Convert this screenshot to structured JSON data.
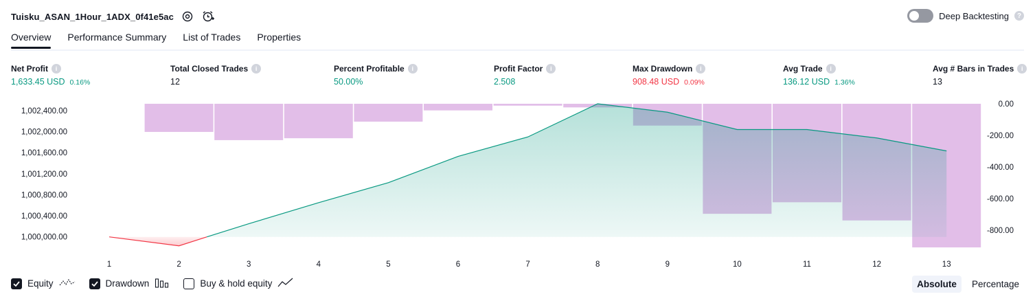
{
  "header": {
    "strategy_title": "Tuisku_ASAN_1Hour_1ADX_0f41e5ac",
    "deep_backtesting_label": "Deep Backtesting",
    "help_glyph": "?"
  },
  "tabs": [
    {
      "label": "Overview",
      "active": true
    },
    {
      "label": "Performance Summary",
      "active": false
    },
    {
      "label": "List of Trades",
      "active": false
    },
    {
      "label": "Properties",
      "active": false
    }
  ],
  "metrics": [
    {
      "label": "Net Profit",
      "value": "1,633.45 USD",
      "pct": "0.16%",
      "color": "#089981"
    },
    {
      "label": "Total Closed Trades",
      "value": "12",
      "pct": "",
      "color": "#131722"
    },
    {
      "label": "Percent Profitable",
      "value": "50.00%",
      "pct": "",
      "color": "#089981"
    },
    {
      "label": "Profit Factor",
      "value": "2.508",
      "pct": "",
      "color": "#089981"
    },
    {
      "label": "Max Drawdown",
      "value": "908.48 USD",
      "pct": "0.09%",
      "color": "#f23645"
    },
    {
      "label": "Avg Trade",
      "value": "136.12 USD",
      "pct": "1.36%",
      "color": "#089981"
    },
    {
      "label": "Avg # Bars in Trades",
      "value": "13",
      "pct": "",
      "color": "#131722"
    }
  ],
  "info_glyph": "i",
  "chart_data": {
    "type": "line",
    "x": [
      1,
      2,
      3,
      4,
      5,
      6,
      7,
      8,
      9,
      10,
      11,
      12,
      13
    ],
    "x_ticks": [
      "1",
      "2",
      "3",
      "4",
      "5",
      "6",
      "7",
      "8",
      "9",
      "10",
      "11",
      "12",
      "13"
    ],
    "left_axis": {
      "ticks": [
        "1,002,400.00",
        "1,002,000.00",
        "1,001,600.00",
        "1,001,200.00",
        "1,000,800.00",
        "1,000,400.00",
        "1,000,000.00"
      ],
      "tick_values": [
        1002400,
        1002000,
        1001600,
        1001200,
        1000800,
        1000400,
        1000000
      ],
      "ylim": [
        999800,
        1002530
      ]
    },
    "right_axis": {
      "ticks": [
        "0.00",
        "-200.00",
        "-400.00",
        "-600.00",
        "-800.00"
      ],
      "tick_values": [
        0,
        -200,
        -400,
        -600,
        -800
      ],
      "ylim": [
        -908.48,
        0
      ]
    },
    "series": [
      {
        "name": "Equity",
        "axis": "left",
        "x": [
          1,
          2,
          2.4,
          3,
          4,
          5,
          6,
          7,
          8,
          9,
          10,
          11,
          12,
          13
        ],
        "values": [
          1000000,
          999830,
          1000000,
          1000250,
          1000650,
          1001030,
          1001530,
          1001900,
          1002530,
          1002370,
          1002040,
          1002040,
          1001880,
          1001633.45
        ]
      },
      {
        "name": "Drawdown",
        "axis": "right",
        "bars": [
          {
            "x": 2,
            "value": -178
          },
          {
            "x": 3,
            "value": -230
          },
          {
            "x": 4,
            "value": -218
          },
          {
            "x": 5,
            "value": -113
          },
          {
            "x": 6,
            "value": -42
          },
          {
            "x": 7,
            "value": -12
          },
          {
            "x": 8,
            "value": -23
          },
          {
            "x": 9,
            "value": -138
          },
          {
            "x": 10,
            "value": -696
          },
          {
            "x": 11,
            "value": -623
          },
          {
            "x": 12,
            "value": -738
          },
          {
            "x": 13,
            "value": -908.48
          }
        ]
      }
    ],
    "colors": {
      "equity_positive": "#089981",
      "equity_negative": "#f23645",
      "drawdown": "#ce93d8"
    }
  },
  "legend": [
    {
      "label": "Equity",
      "checked": true,
      "icon": "equity-line-icon"
    },
    {
      "label": "Drawdown",
      "checked": true,
      "icon": "drawdown-bars-icon"
    },
    {
      "label": "Buy & hold equity",
      "checked": false,
      "icon": "buy-hold-line-icon"
    }
  ],
  "mode_buttons": [
    {
      "label": "Absolute",
      "active": true
    },
    {
      "label": "Percentage",
      "active": false
    }
  ]
}
